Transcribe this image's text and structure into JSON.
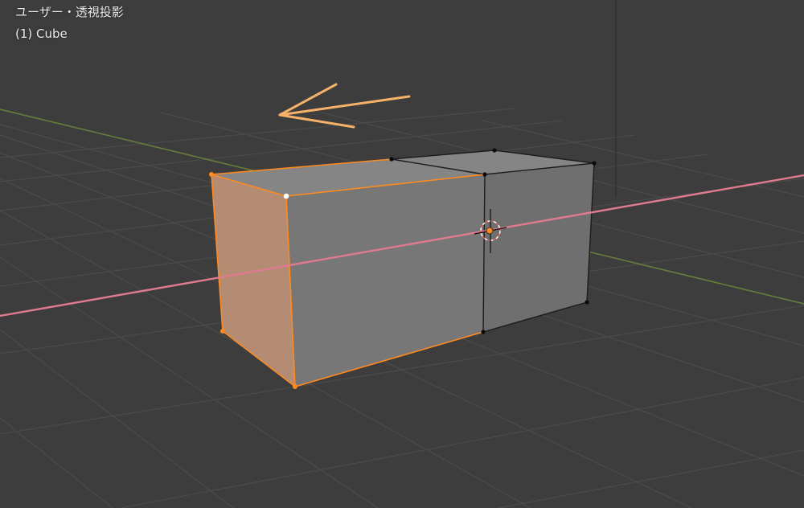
{
  "viewport": {
    "view_label": "ユーザー・透視投影",
    "object_info": "(1) Cube",
    "background_color": "#3d3d3d",
    "grid_color": "#484848",
    "x_axis_color": "#e07a8d",
    "y_axis_color": "#6d8a3d",
    "selection_color": "#ff8a1f",
    "active_vertex_color": "#ffffff",
    "annotation_arrow_color": "#f7b26a",
    "scene": {
      "object_name": "Cube",
      "selected_face": "end face (left)",
      "active_element": "vertex",
      "annotation": "orange arrow pointing left"
    }
  }
}
